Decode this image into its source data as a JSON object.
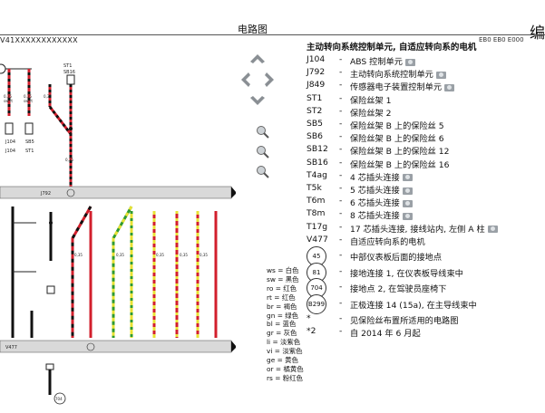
{
  "header": {
    "title": "电路图",
    "right_char": "编",
    "code_left": "V41XXXXXXXXXXXX",
    "code_right": "EB0 EB0 E000"
  },
  "nav": {
    "up": "arrow-up",
    "down": "arrow-down",
    "left": "arrow-left",
    "right": "arrow-right",
    "zoom_in": "zoom-in",
    "zoom_reset": "zoom-reset",
    "zoom_out": "zoom-out"
  },
  "legend": {
    "title": "主动转向系统控制单元, 自适应转向系的电机",
    "items": [
      {
        "code": "J104",
        "desc": "ABS 控制单元",
        "cam": true
      },
      {
        "code": "J792",
        "desc": "主动转向系统控制单元",
        "cam": true
      },
      {
        "code": "J849",
        "desc": "传感器电子装置控制单元",
        "cam": true
      },
      {
        "code": "ST1",
        "desc": "保险丝架 1",
        "cam": false
      },
      {
        "code": "ST2",
        "desc": "保险丝架 2",
        "cam": false
      },
      {
        "code": "SB5",
        "desc": "保险丝架 B 上的保险丝 5",
        "cam": false
      },
      {
        "code": "SB6",
        "desc": "保险丝架 B 上的保险丝 6",
        "cam": false
      },
      {
        "code": "SB12",
        "desc": "保险丝架 B 上的保险丝 12",
        "cam": false
      },
      {
        "code": "SB16",
        "desc": "保险丝架 B 上的保险丝 16",
        "cam": false
      },
      {
        "code": "T4ag",
        "desc": "4 芯插头连接",
        "cam": true
      },
      {
        "code": "T5k",
        "desc": "5 芯插头连接",
        "cam": true
      },
      {
        "code": "T6m",
        "desc": "6 芯插头连接",
        "cam": true
      },
      {
        "code": "T8m",
        "desc": "8 芯插头连接",
        "cam": true
      },
      {
        "code": "T17g",
        "desc": "17 芯插头连接, 接线站内, 左侧 A 柱",
        "cam": true
      },
      {
        "code": "V477",
        "desc": "自适应转向系的电机",
        "cam": false
      }
    ],
    "grounds": [
      {
        "num": "45",
        "desc": "中部仪表板后面的接地点"
      },
      {
        "num": "81",
        "desc": "接地连接 1, 在仪表板导线束中"
      },
      {
        "num": "704",
        "desc": "接地点 2, 在驾驶员座椅下"
      },
      {
        "num": "B299",
        "desc": "正极连接 14 (15a), 在主导线束中"
      }
    ],
    "notes": [
      {
        "mark": "*",
        "desc": "见保险丝布置所适用的电路图"
      },
      {
        "mark": "*2",
        "desc": "自 2014 年 6 月起"
      }
    ]
  },
  "color_legend": [
    "ws = 白色",
    "sw = 黑色",
    "ro = 红色",
    "rt = 红色",
    "br = 褐色",
    "gn = 绿色",
    "bl = 蓝色",
    "gr = 灰色",
    "li = 淡紫色",
    "vi = 淡紫色",
    "ge = 黄色",
    "or = 橘黄色",
    "rs = 粉红色"
  ],
  "diagram_labels": {
    "st_top": "ST1",
    "sb_top": "SB16",
    "fuse1": "J104",
    "fuse2": "SB5",
    "fuse3": "J104",
    "fuse4": "ST1",
    "bus_label": "J792",
    "bottom_label": "V477",
    "wire_labels": [
      "0,35 sw/rt",
      "0,35 sw/rt",
      "0,35 sw/rt",
      "0,35 sw/rt",
      "0,35 sw/rt"
    ],
    "gnd_label": "704"
  }
}
